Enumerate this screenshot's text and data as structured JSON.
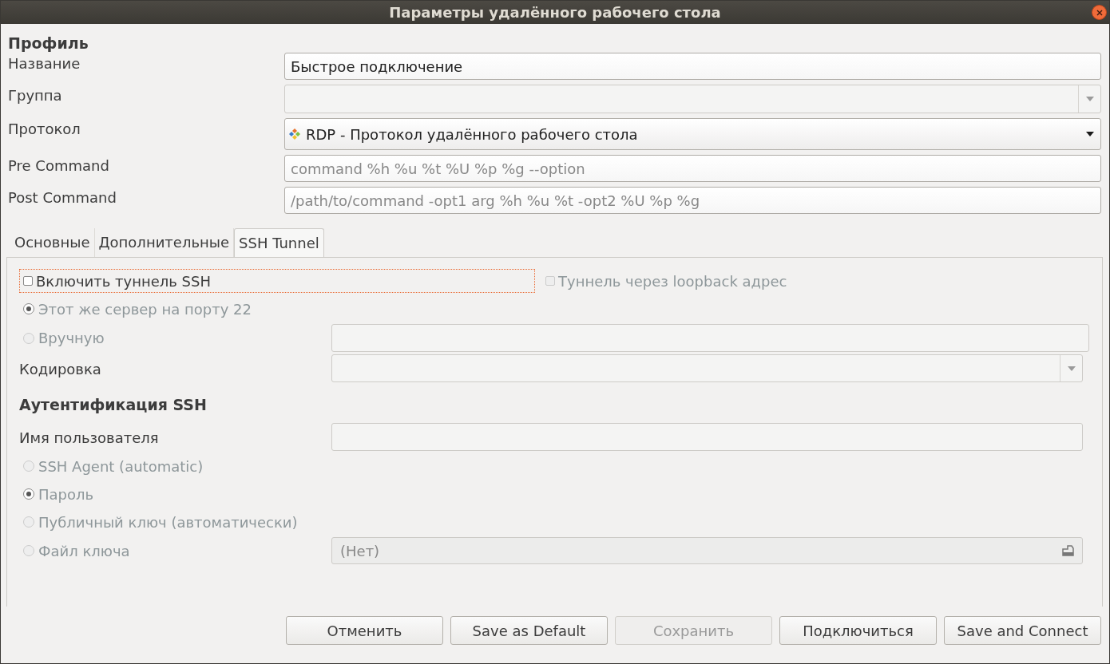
{
  "window": {
    "title": "Параметры удалённого рабочего стола"
  },
  "profile": {
    "heading": "Профиль",
    "fields": [
      {
        "label": "Название",
        "kind": "text",
        "value": "Быстрое подключение",
        "disabled": false
      },
      {
        "label": "Группа",
        "kind": "combo",
        "disabled": true
      },
      {
        "label": "Протокол",
        "kind": "select",
        "value": "RDP - Протокол удалённого рабочего стола",
        "disabled": false
      },
      {
        "label": "Pre Command",
        "kind": "text",
        "placeholder": "command %h %u %t %U %p %g --option",
        "disabled": false
      },
      {
        "label": "Post Command",
        "kind": "text",
        "placeholder": "/path/to/command -opt1 arg %h %u %t -opt2 %U %p %g",
        "disabled": false
      }
    ]
  },
  "tabs": [
    {
      "label": "Основные",
      "selected": false
    },
    {
      "label": "Дополнительные",
      "selected": false
    },
    {
      "label": "SSH Tunnel",
      "selected": true
    }
  ],
  "ssh": [
    {
      "kind": "checks",
      "label": "Включить туннель SSH",
      "checked": false,
      "focused": true,
      "label2": "Туннель через loopback адрес",
      "checked2": false,
      "disabled2": true
    },
    {
      "kind": "radio",
      "label": "Этот же сервер на порту 22",
      "selected": true,
      "disabled": true
    },
    {
      "kind": "radio_field",
      "label": "Вручную",
      "selected": false,
      "disabled": true
    },
    {
      "kind": "label_combo",
      "label": "Кодировка",
      "disabled": true
    },
    {
      "kind": "heading",
      "label": "Аутентификация SSH"
    },
    {
      "kind": "label_field",
      "label": "Имя пользователя",
      "disabled": true
    },
    {
      "kind": "radio",
      "label": "SSH Agent (automatic)",
      "selected": false,
      "disabled": true
    },
    {
      "kind": "radio",
      "label": "Пароль",
      "selected": true,
      "disabled": true
    },
    {
      "kind": "radio",
      "label": "Публичный ключ (автоматически)",
      "selected": false,
      "disabled": true
    },
    {
      "kind": "radio_file",
      "label": "Файл ключа",
      "selected": false,
      "disabled": true,
      "value": "(Нет)"
    }
  ],
  "buttons": [
    {
      "label": "Отменить",
      "disabled": false
    },
    {
      "label": "Save as Default",
      "disabled": false
    },
    {
      "label": "Сохранить",
      "disabled": true
    },
    {
      "label": "Подключиться",
      "disabled": false
    },
    {
      "label": "Save and Connect",
      "disabled": false
    }
  ]
}
